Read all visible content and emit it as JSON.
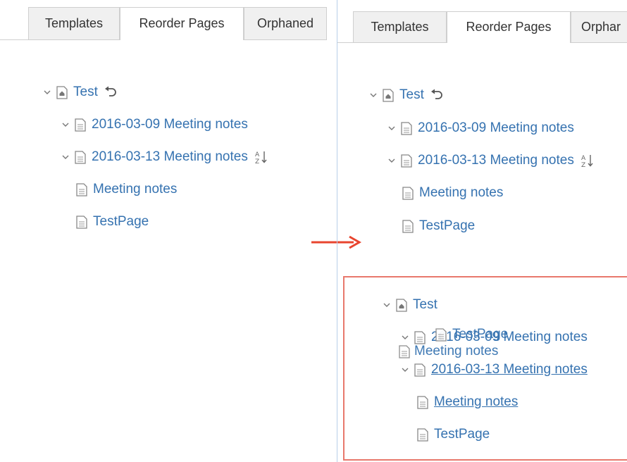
{
  "tabs": {
    "templates": "Templates",
    "reorder_pages": "Reorder Pages",
    "orphaned_left": "Orphaned",
    "orphaned_right": "Orphar"
  },
  "tree": {
    "root": "Test",
    "child_1": "2016-03-09 Meeting notes",
    "child_2": "2016-03-13 Meeting notes",
    "grandchild_1": "Meeting notes",
    "grandchild_2": "TestPage"
  },
  "drag_preview": {
    "root": "Test",
    "overlap_child": "2016-03-09 Meeting notes",
    "overlap_dragged": "TestPage",
    "dragged_item": "Meeting notes",
    "child_2": "2016-03-13 Meeting notes",
    "grandchild_1": "Meeting notes",
    "grandchild_2": "TestPage"
  },
  "colors": {
    "link": "#3572b0",
    "arrow": "#e8452f",
    "highlight_border": "#e8786c"
  },
  "icons": {
    "root_page": "home-page-icon",
    "page": "page-icon",
    "expand": "chevron-down-icon",
    "undo": "undo-icon",
    "sort": "sort-alpha-icon"
  }
}
